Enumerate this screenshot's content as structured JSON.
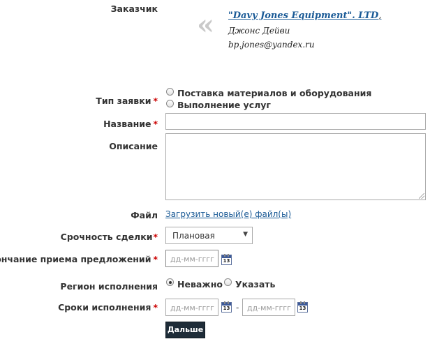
{
  "customer": {
    "label": "Заказчик",
    "company": "\"Davy Jones Equipment\". LTD",
    "company_suffix": ",",
    "contact_name": "Джонс Дейви",
    "email": "bp.jones@yandex.ru"
  },
  "request_type": {
    "label": "Тип заявки",
    "required_mark": "*",
    "options": [
      "Поставка материалов и оборудования",
      "Выполнение услуг"
    ]
  },
  "title_field": {
    "label": "Название",
    "required_mark": "*",
    "value": ""
  },
  "description_field": {
    "label": "Описание",
    "value": ""
  },
  "file_field": {
    "label": "Файл",
    "upload_link": "Загрузить новый(е) файл(ы)"
  },
  "urgency": {
    "label": "Срочность сделки",
    "required_mark": "*",
    "selected": "Плановая"
  },
  "deadline": {
    "label": "Окончание приема предложений",
    "required_mark": "*",
    "placeholder": "дд-мм-гггг"
  },
  "region": {
    "label": "Регион исполнения",
    "options": [
      "Неважно",
      "Указать"
    ],
    "selected": "Неважно"
  },
  "terms": {
    "label": "Сроки исполнения",
    "required_mark": "*",
    "from_placeholder": "дд-мм-гггг",
    "to_placeholder": "дд-мм-гггг",
    "separator": "-"
  },
  "calendar_icon_text": "13",
  "quote_glyph": "«",
  "submit_label": "Дальше"
}
